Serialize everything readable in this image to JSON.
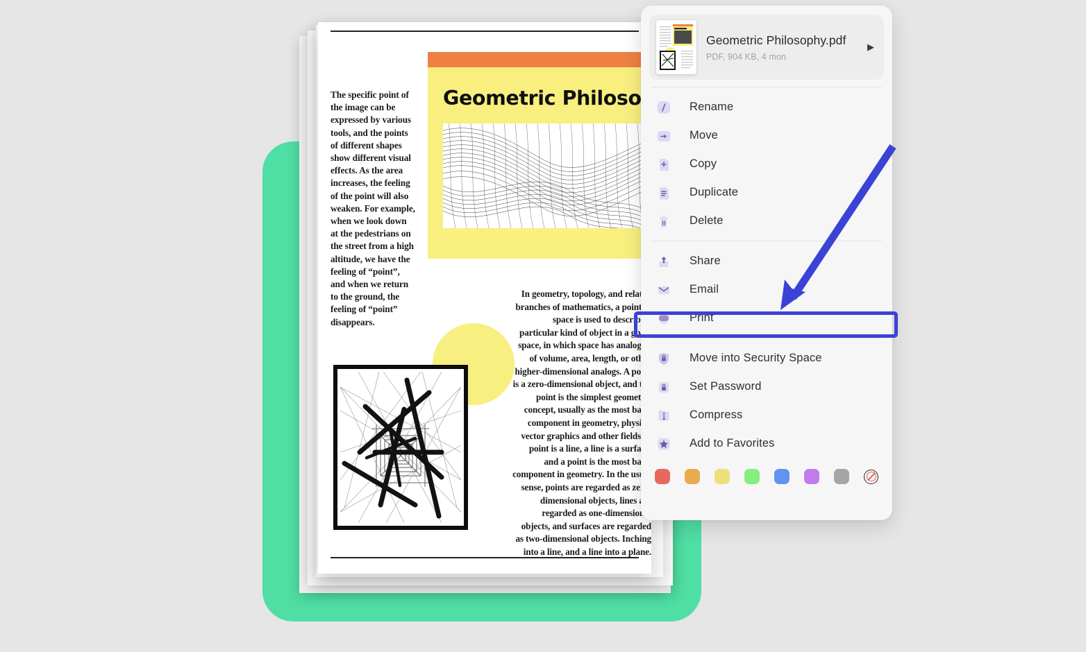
{
  "document": {
    "title": "Geometric Philosophy",
    "left_column_text": "The specific point of the image can be expressed by various tools, and the points of different shapes show different visual effects. As the area increases, the feeling of the point will also weaken. For example, when we look down at the pedestrians on the street from a high altitude, we have the feeling of “point”, and when we return to the ground, the feeling of “point” disappears.",
    "right_column_text": "In geometry, topology, and related branches of mathematics, a point in space is used to describe a particular kind of object in a given space, in which space has analogies of volume, area, length, or other higher-dimensional analogs. A point is a zero-dimensional object, and the point is the simplest geometric concept, usually as the most basic component in geometry, physics, vector graphics and other fields. A point is a line, a line is a surface, and a point is the most basic component in geometry. In the usual sense, points are regarded as zero-dimensional objects, lines are regarded as one-dimensional objects, and surfaces are regarded as two-dimensional objects. Inching into a line, and a line into a plane.",
    "colors": {
      "header_bar": "#ef8143",
      "header_panel": "#f9ef7f",
      "accent_circle": "#f7ef80",
      "card_background": "#4fdfa4"
    }
  },
  "menu": {
    "file": {
      "name": "Geometric Philosophy.pdf",
      "details": "PDF, 904 KB, 4 mon",
      "chevron": "▶"
    },
    "groups": [
      {
        "name": "file-actions",
        "items": [
          {
            "label": "Rename",
            "icon": "rename-icon"
          },
          {
            "label": "Move",
            "icon": "move-icon"
          },
          {
            "label": "Copy",
            "icon": "copy-icon"
          },
          {
            "label": "Duplicate",
            "icon": "duplicate-icon"
          },
          {
            "label": "Delete",
            "icon": "trash-icon"
          }
        ]
      },
      {
        "name": "share-actions",
        "items": [
          {
            "label": "Share",
            "icon": "share-icon"
          },
          {
            "label": "Email",
            "icon": "envelope-icon"
          },
          {
            "label": "Print",
            "icon": "printer-icon",
            "highlighted": true
          }
        ]
      },
      {
        "name": "security-actions",
        "items": [
          {
            "label": "Move into Security Space",
            "icon": "shield-lock-icon"
          },
          {
            "label": "Set Password",
            "icon": "lock-icon"
          },
          {
            "label": "Compress",
            "icon": "zip-folder-icon"
          },
          {
            "label": "Add to Favorites",
            "icon": "star-icon"
          }
        ]
      }
    ],
    "tag_swatches": [
      {
        "name": "red",
        "color": "#e8685e"
      },
      {
        "name": "orange",
        "color": "#e8ab50"
      },
      {
        "name": "yellow",
        "color": "#ebe07a"
      },
      {
        "name": "green",
        "color": "#84ef7e"
      },
      {
        "name": "blue",
        "color": "#6294ef"
      },
      {
        "name": "purple",
        "color": "#c07cef"
      },
      {
        "name": "gray",
        "color": "#a5a5a5"
      },
      {
        "name": "none",
        "color": "#e0645a"
      }
    ]
  },
  "annotations": {
    "arrow_color": "#3b42d6",
    "highlight_color": "#3b42d6",
    "highlight_target": "Print"
  }
}
